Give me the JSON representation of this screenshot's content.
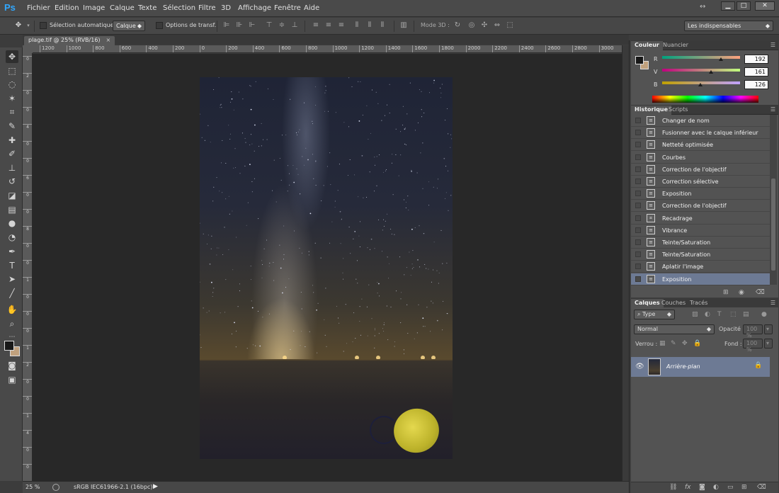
{
  "app": {
    "logo": "Ps",
    "menu": [
      "Fichier",
      "Edition",
      "Image",
      "Calque",
      "Texte",
      "Sélection",
      "Filtre",
      "3D",
      "Affichage",
      "Fenêtre",
      "Aide"
    ],
    "window_controls": [
      "▁",
      "□",
      "✕"
    ]
  },
  "options_bar": {
    "auto_select_label": "Sélection automatique :",
    "auto_select_value": "Calque",
    "transform_label": "Options de transf.",
    "mode3d_label": "Mode 3D :",
    "workspace_value": "Les indispensables"
  },
  "document": {
    "tab_label": "plage.tif @ 25% (RVB/16)",
    "tab_close": "×",
    "ruler_top_ticks": [
      "1200",
      "1000",
      "800",
      "600",
      "400",
      "200",
      "0",
      "200",
      "400",
      "600",
      "800",
      "1000",
      "1200",
      "1400",
      "1600",
      "1800",
      "2000",
      "2200",
      "2400",
      "2600",
      "2800",
      "3000"
    ],
    "ruler_left_ticks": [
      "0",
      "2",
      "0",
      "0",
      "4",
      "0",
      "0",
      "6",
      "0",
      "0",
      "8",
      "0",
      "0",
      "1",
      "0",
      "0",
      "0",
      "1",
      "2",
      "0",
      "0",
      "1",
      "4",
      "0",
      "0"
    ]
  },
  "status": {
    "zoom": "25 %",
    "profile": "sRGB IEC61966-2.1 (16bpc)",
    "arrow": "▶"
  },
  "color_panel": {
    "tabs": [
      "Couleur",
      "Nuancier"
    ],
    "channels": [
      {
        "label": "R",
        "value": "192",
        "fraction": 0.753,
        "gradient": "linear-gradient(90deg, #00a17e, #ffa17e)"
      },
      {
        "label": "V",
        "value": "161",
        "fraction": 0.631,
        "gradient": "linear-gradient(90deg, #c0007e, #c0ff7e)"
      },
      {
        "label": "B",
        "value": "126",
        "fraction": 0.494,
        "gradient": "linear-gradient(90deg, #c0a100, #c0a1ff)"
      }
    ]
  },
  "history_panel": {
    "tabs": [
      "Historique",
      "Scripts"
    ],
    "items": [
      "Changer de nom",
      "Fusionner avec le calque inférieur",
      "Netteté optimisée",
      "Courbes",
      "Correction de l'objectif",
      "Correction sélective",
      "Exposition",
      "Correction de l'objectif",
      "Recadrage",
      "Vibrance",
      "Teinte/Saturation",
      "Teinte/Saturation",
      "Aplatir l'image",
      "Exposition"
    ]
  },
  "layers_panel": {
    "tabs": [
      "Calques",
      "Couches",
      "Tracés"
    ],
    "filter_label": "Type",
    "blend_mode": "Normal",
    "opacity_label": "Opacité :",
    "opacity_value": "100 %",
    "lock_label": "Verrou :",
    "fill_label": "Fond :",
    "fill_value": "100 %",
    "layer_name": "Arrière-plan"
  }
}
